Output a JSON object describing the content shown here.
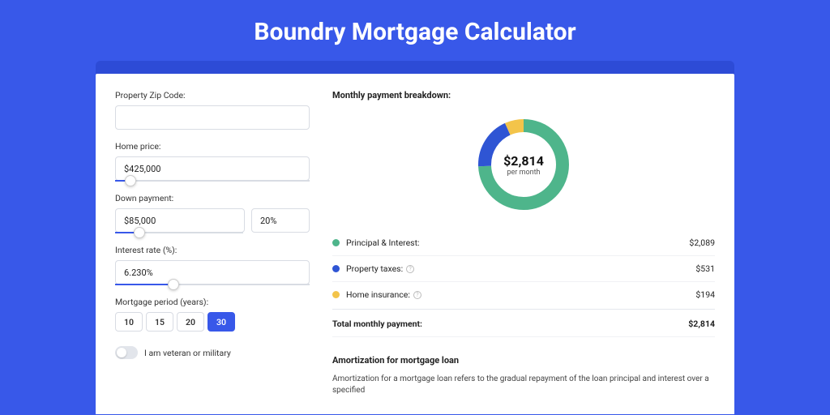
{
  "title": "Boundry Mortgage Calculator",
  "form": {
    "zip_label": "Property Zip Code:",
    "zip_value": "",
    "home_price_label": "Home price:",
    "home_price_value": "$425,000",
    "home_price_slider_pct": 8,
    "down_label": "Down payment:",
    "down_value": "$85,000",
    "down_pct_value": "20%",
    "down_slider_pct": 19,
    "rate_label": "Interest rate (%):",
    "rate_value": "6.230%",
    "rate_slider_pct": 30,
    "period_label": "Mortgage period (years):",
    "periods": [
      "10",
      "15",
      "20",
      "30"
    ],
    "period_active": "30",
    "veteran_label": "I am veteran or military"
  },
  "breakdown": {
    "header": "Monthly payment breakdown:",
    "center_amount": "$2,814",
    "center_sub": "per month",
    "items": [
      {
        "label": "Principal & Interest:",
        "value": "$2,089",
        "color": "#4eb58b",
        "has_info": false
      },
      {
        "label": "Property taxes:",
        "value": "$531",
        "color": "#2f55d4",
        "has_info": true
      },
      {
        "label": "Home insurance:",
        "value": "$194",
        "color": "#f3c44a",
        "has_info": true
      }
    ],
    "total_label": "Total monthly payment:",
    "total_value": "$2,814"
  },
  "amort": {
    "header": "Amortization for mortgage loan",
    "text": "Amortization for a mortgage loan refers to the gradual repayment of the loan principal and interest over a specified"
  },
  "chart_data": {
    "type": "pie",
    "title": "Monthly payment breakdown",
    "categories": [
      "Principal & Interest",
      "Property taxes",
      "Home insurance"
    ],
    "values": [
      2089,
      531,
      194
    ],
    "colors": [
      "#4eb58b",
      "#2f55d4",
      "#f3c44a"
    ],
    "total": 2814,
    "unit": "USD per month"
  }
}
